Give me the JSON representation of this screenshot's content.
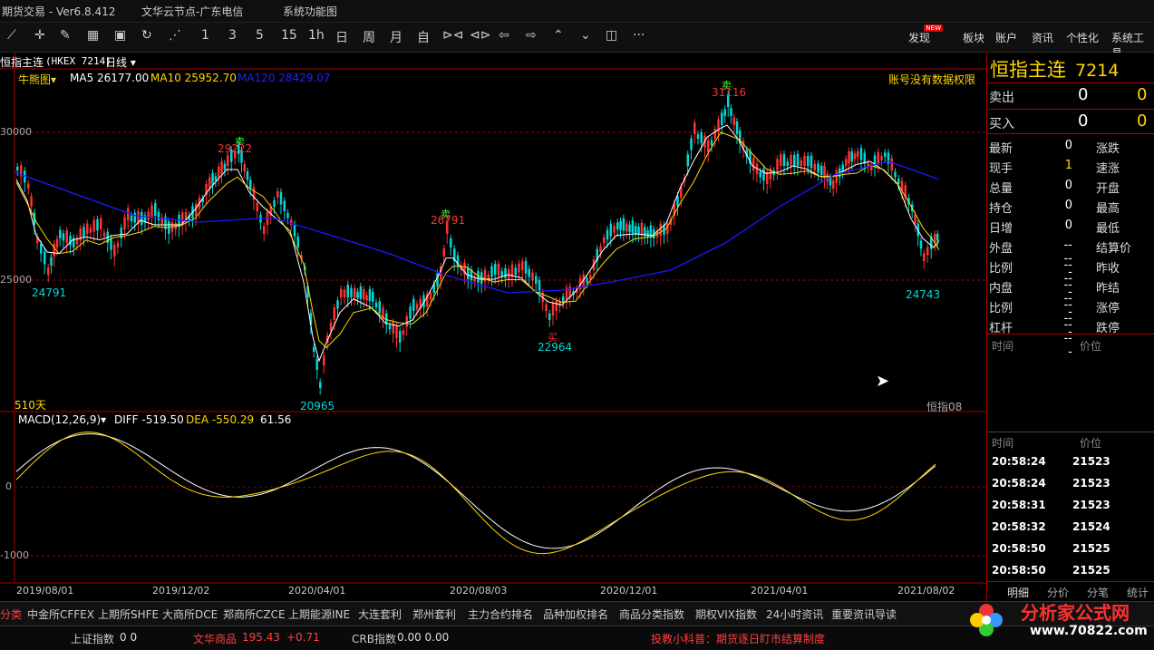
{
  "titlebar": {
    "app_name": "期货交易 - Ver6.8.412",
    "server": "文华云节点-广东电信",
    "menu": "系统功能图"
  },
  "toolbar": {
    "periods": [
      "1",
      "3",
      "5",
      "15",
      "1h",
      "日",
      "周",
      "月",
      "自"
    ],
    "right": [
      "发现",
      "板块",
      "账户",
      "资讯",
      "个性化",
      "系统工具"
    ],
    "new_badge": "NEW",
    "more": "···"
  },
  "chart_header": {
    "symbol": "恒指主连",
    "code": "(HKEX 7214)",
    "period": "日线",
    "indicator": "牛熊图",
    "ma5": "MA5 26177.00",
    "ma10": "MA10 25952.70",
    "ma120": "MA120 28429.07",
    "no_permission": "账号没有数据权限",
    "bar_count": "510天",
    "index_name": "恒指08"
  },
  "price_axis": [
    "30000",
    "25000"
  ],
  "annotations": [
    {
      "label": "29222",
      "mark": "卖"
    },
    {
      "label": "26791",
      "mark": "卖"
    },
    {
      "label": "31116",
      "mark": "卖"
    },
    {
      "label": "24791",
      "mark": ""
    },
    {
      "label": "20965",
      "mark": ""
    },
    {
      "label": "22964",
      "mark": "买"
    },
    {
      "label": "24743",
      "mark": ""
    }
  ],
  "macd_header": {
    "name": "MACD(12,26,9)",
    "diff": "DIFF -519.50",
    "dea": "DEA -550.29",
    "macd": "61.56",
    "zero": "0",
    "neg": "-1000"
  },
  "x_axis": [
    "2019/08/01",
    "2019/12/02",
    "2020/04/01",
    "2020/08/03",
    "2020/12/01",
    "2021/04/01",
    "2021/08/02"
  ],
  "quote": {
    "name": "恒指主连",
    "code": "7214",
    "sell_label": "卖出",
    "sell_price": "0",
    "sell_vol": "0",
    "buy_label": "买入",
    "buy_price": "0",
    "buy_vol": "0",
    "rows": [
      {
        "l": "最新",
        "v": "0",
        "r": "涨跌"
      },
      {
        "l": "现手",
        "v": "1",
        "r": "速涨"
      },
      {
        "l": "总量",
        "v": "0",
        "r": "开盘"
      },
      {
        "l": "持仓",
        "v": "0",
        "r": "最高"
      },
      {
        "l": "日增",
        "v": "0",
        "r": "最低"
      },
      {
        "l": "外盘",
        "v": "-----",
        "r": "结算价"
      },
      {
        "l": "比例",
        "v": "-----",
        "r": "昨收"
      },
      {
        "l": "内盘",
        "v": "-----",
        "r": "昨结"
      },
      {
        "l": "比例",
        "v": "-----",
        "r": "涨停"
      },
      {
        "l": "杠杆",
        "v": "-----",
        "r": "跌停"
      }
    ],
    "time_hdr": "时间",
    "price_hdr": "价位",
    "ticks": [
      {
        "t": "20:58:24",
        "p": "21523"
      },
      {
        "t": "20:58:24",
        "p": "21523"
      },
      {
        "t": "20:58:31",
        "p": "21523"
      },
      {
        "t": "20:58:32",
        "p": "21524"
      },
      {
        "t": "20:58:50",
        "p": "21525"
      },
      {
        "t": "20:58:50",
        "p": "21525"
      }
    ],
    "tabs": [
      "明细",
      "分价",
      "分笔",
      "统计"
    ]
  },
  "bottom_tabs": [
    "分类",
    "中金所CFFEX",
    "上期所SHFE",
    "大商所DCE",
    "郑商所CZCE",
    "上期能源INE",
    "大连套利",
    "郑州套利",
    "主力合约排名",
    "品种加权排名",
    "商品分类指数",
    "期权VIX指数",
    "24小时资讯",
    "重要资讯导读"
  ],
  "status": {
    "sh_label": "上证指数",
    "sh_val": "0  0",
    "wh_label": "文华商品",
    "wh_val": "195.43",
    "wh_chg": "+0.71",
    "crb_label": "CRB指数",
    "crb_val": "0.00  0.00",
    "tip": "投教小科普：期货逐日盯市结算制度"
  },
  "watermark": {
    "cn": "分析家公式网",
    "url": "www.70822.com"
  },
  "colors": {
    "up": "#ff3030",
    "down": "#00d8d8",
    "accent": "#c00"
  }
}
